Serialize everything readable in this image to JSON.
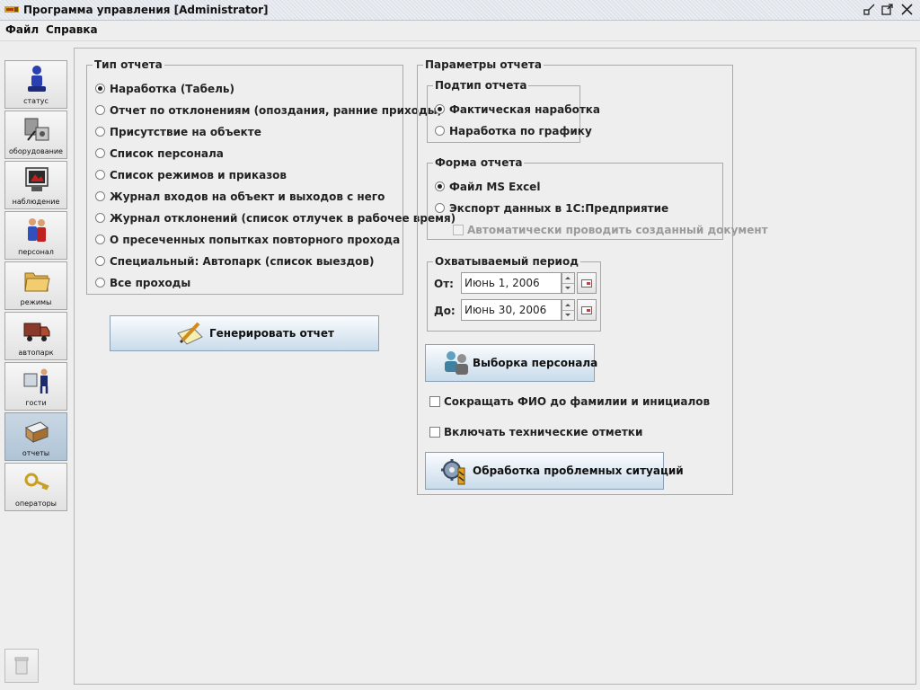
{
  "window": {
    "title": "Программа управления [Administrator]"
  },
  "menu": [
    "Файл",
    "Справка"
  ],
  "sidebar": {
    "items": [
      {
        "label": "статус",
        "icon": "status-icon"
      },
      {
        "label": "оборудование",
        "icon": "equipment-icon"
      },
      {
        "label": "наблюдение",
        "icon": "monitoring-icon"
      },
      {
        "label": "персонал",
        "icon": "personnel-icon"
      },
      {
        "label": "режимы",
        "icon": "folder-icon"
      },
      {
        "label": "автопарк",
        "icon": "truck-icon"
      },
      {
        "label": "гости",
        "icon": "guest-icon"
      },
      {
        "label": "отчеты",
        "icon": "reports-icon",
        "active": true
      },
      {
        "label": "операторы",
        "icon": "key-icon"
      }
    ]
  },
  "report_type": {
    "legend": "Тип отчета",
    "selected_index": 0,
    "options": [
      "Наработка (Табель)",
      "Отчет по отклонениям (опоздания, ранние приходы)",
      "Присутствие на объекте",
      "Список персонала",
      "Список режимов и приказов",
      "Журнал входов на объект и выходов с него",
      "Журнал отклонений (список отлучек в рабочее время)",
      "О пресеченных попытках повторного прохода",
      "Специальный: Автопарк (список выездов)",
      "Все проходы"
    ]
  },
  "generate_button": {
    "label": "Генерировать отчет"
  },
  "params": {
    "legend": "Параметры отчета",
    "subtype": {
      "legend": "Подтип отчета",
      "selected_index": 0,
      "options": [
        "Фактическая наработка",
        "Наработка по графику"
      ]
    },
    "form": {
      "legend": "Форма отчета",
      "selected_index": 0,
      "options": [
        "Файл MS Excel",
        "Экспорт данных в 1С:Предприятие"
      ],
      "auto_post_label": "Автоматически проводить созданный документ"
    },
    "period": {
      "legend": "Охватываемый период",
      "from_label": "От:",
      "from_value": "Июнь 1, 2006",
      "to_label": "До:",
      "to_value": "Июнь 30, 2006"
    },
    "select_staff_button": {
      "label": "Выборка персонала"
    },
    "shorten_names_label": "Сокращать ФИО до фамилии и инициалов",
    "tech_marks_label": "Включать технические отметки",
    "problem_button": {
      "label": "Обработка проблемных ситуаций"
    }
  },
  "colors": {
    "background": "#eeeeee",
    "button_gradient_bottom": "#c9dbea",
    "active_tab": "#b0c4d6"
  }
}
